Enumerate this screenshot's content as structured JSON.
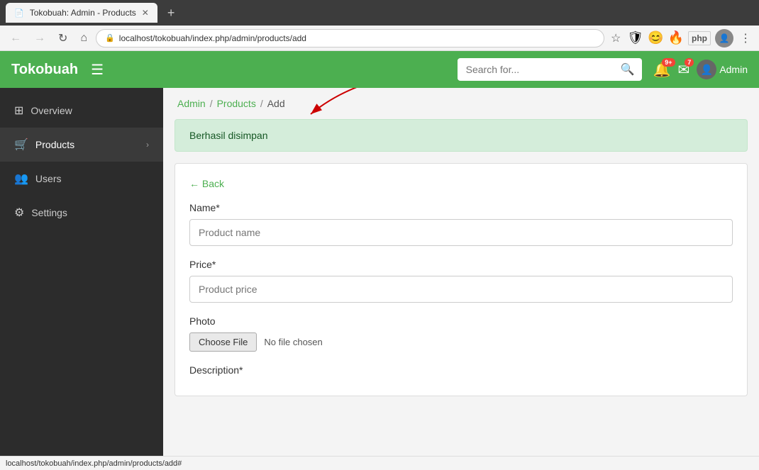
{
  "browser": {
    "tab_title": "Tokobuah: Admin - Products",
    "tab_icon": "📄",
    "new_tab_icon": "+",
    "back_disabled": true,
    "forward_disabled": true,
    "reload_label": "↻",
    "home_label": "⌂",
    "url": "localhost/tokobuah/index.php/admin/products/add",
    "star_label": "☆",
    "menu_label": "⋮",
    "status_url": "localhost/tokobuah/index.php/admin/products/add#"
  },
  "navbar": {
    "brand": "Tokobuah",
    "hamburger": "☰",
    "search_placeholder": "Search for...",
    "search_icon": "🔍",
    "notif_icon": "🔔",
    "notif_badge": "9+",
    "mail_icon": "✉",
    "mail_badge": "7",
    "admin_icon": "👤",
    "admin_label": "Admin"
  },
  "sidebar": {
    "items": [
      {
        "id": "overview",
        "icon": "⊞",
        "label": "Overview",
        "arrow": ""
      },
      {
        "id": "products",
        "icon": "🛒",
        "label": "Products",
        "arrow": "›",
        "active": true
      },
      {
        "id": "users",
        "icon": "👥",
        "label": "Users",
        "arrow": ""
      },
      {
        "id": "settings",
        "icon": "⚙",
        "label": "Settings",
        "arrow": ""
      }
    ]
  },
  "breadcrumb": {
    "admin_link": "Admin",
    "products_link": "Products",
    "current": "Add",
    "sep": "/"
  },
  "success_alert": {
    "message": "Berhasil disimpan"
  },
  "form": {
    "back_label": "← Back",
    "name_label": "Name*",
    "name_placeholder": "Product name",
    "price_label": "Price*",
    "price_placeholder": "Product price",
    "photo_label": "Photo",
    "choose_file_label": "Choose File",
    "no_file_text": "No file chosen",
    "description_label": "Description*"
  }
}
